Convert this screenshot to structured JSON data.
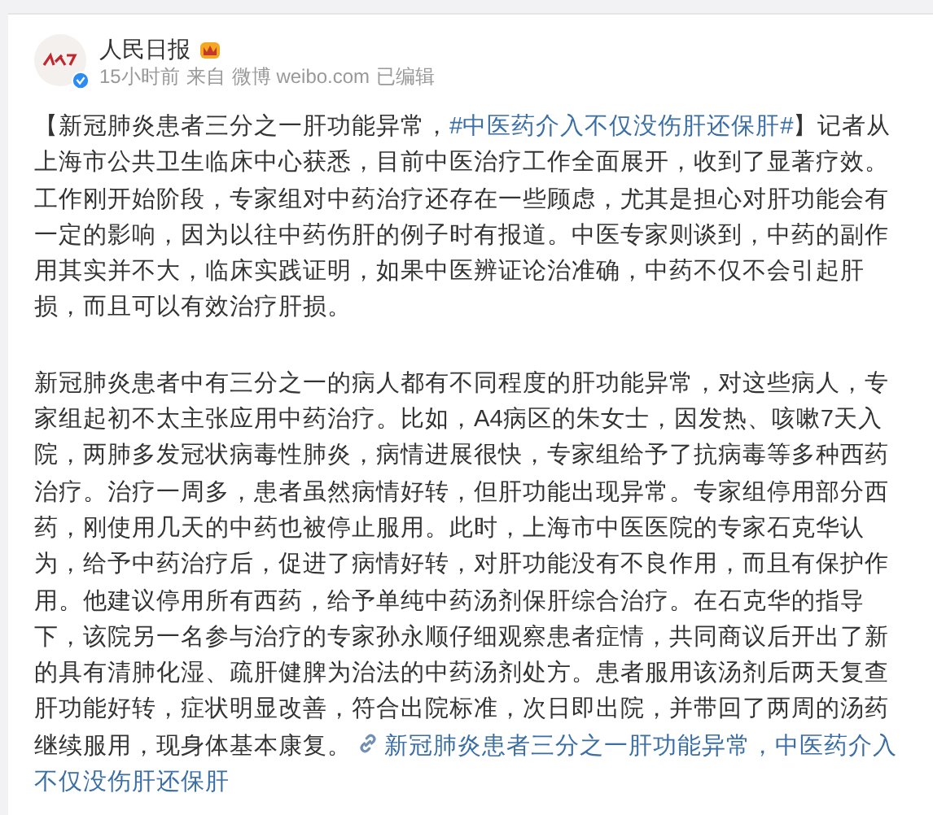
{
  "post": {
    "author": "人民日报",
    "verified": true,
    "time": "15小时前",
    "source_prefix": "来自",
    "source": "微博 weibo.com",
    "edited": "已编辑"
  },
  "paragraphs": [
    {
      "segments": [
        {
          "kind": "text",
          "text": "【新冠肺炎患者三分之一肝功能异常，"
        },
        {
          "kind": "link",
          "text": "#中医药介入不仅没伤肝还保肝#"
        },
        {
          "kind": "text",
          "text": "】记者从上海市公共卫生临床中心获悉，目前中医治疗工作全面展开，收到了显著疗效。工作刚开始阶段，专家组对中药治疗还存在一些顾虑，尤其是担心对肝功能会有一定的影响，因为以往中药伤肝的例子时有报道。中医专家则谈到，中药的副作用其实并不大，临床实践证明，如果中医辨证论治准确，中药不仅不会引起肝损，而且可以有效治疗肝损。"
        }
      ]
    },
    {
      "segments": [
        {
          "kind": "text",
          "text": "新冠肺炎患者中有三分之一的病人都有不同程度的肝功能异常，对这些病人，专家组起初不太主张应用中药治疗。比如，A4病区的朱女士，因发热、咳嗽7天入院，两肺多发冠状病毒性肺炎，病情进展很快，专家组给予了抗病毒等多种西药治疗。治疗一周多，患者虽然病情好转，但肝功能出现异常。专家组停用部分西药，刚使用几天的中药也被停止服用。此时，上海市中医医院的专家石克华认为，给予中药治疗后，促进了病情好转，对肝功能没有不良作用，而且有保护作用。他建议停用所有西药，给予单纯中药汤剂保肝综合治疗。在石克华的指导下，该院另一名参与治疗的专家孙永顺仔细观察患者症情，共同商议后开出了新的具有清肺化湿、疏肝健脾为治法的中药汤剂处方。患者服用该汤剂后两天复查肝功能好转，症状明显改善，符合出院标准，次日即出院，并带回了两周的汤药继续服用，现身体基本康复。"
        },
        {
          "kind": "web_link",
          "lines": [
            "新冠肺炎患者三分之一肝功能异常，中医药介入",
            "不仅没伤肝还保肝"
          ]
        }
      ]
    }
  ]
}
